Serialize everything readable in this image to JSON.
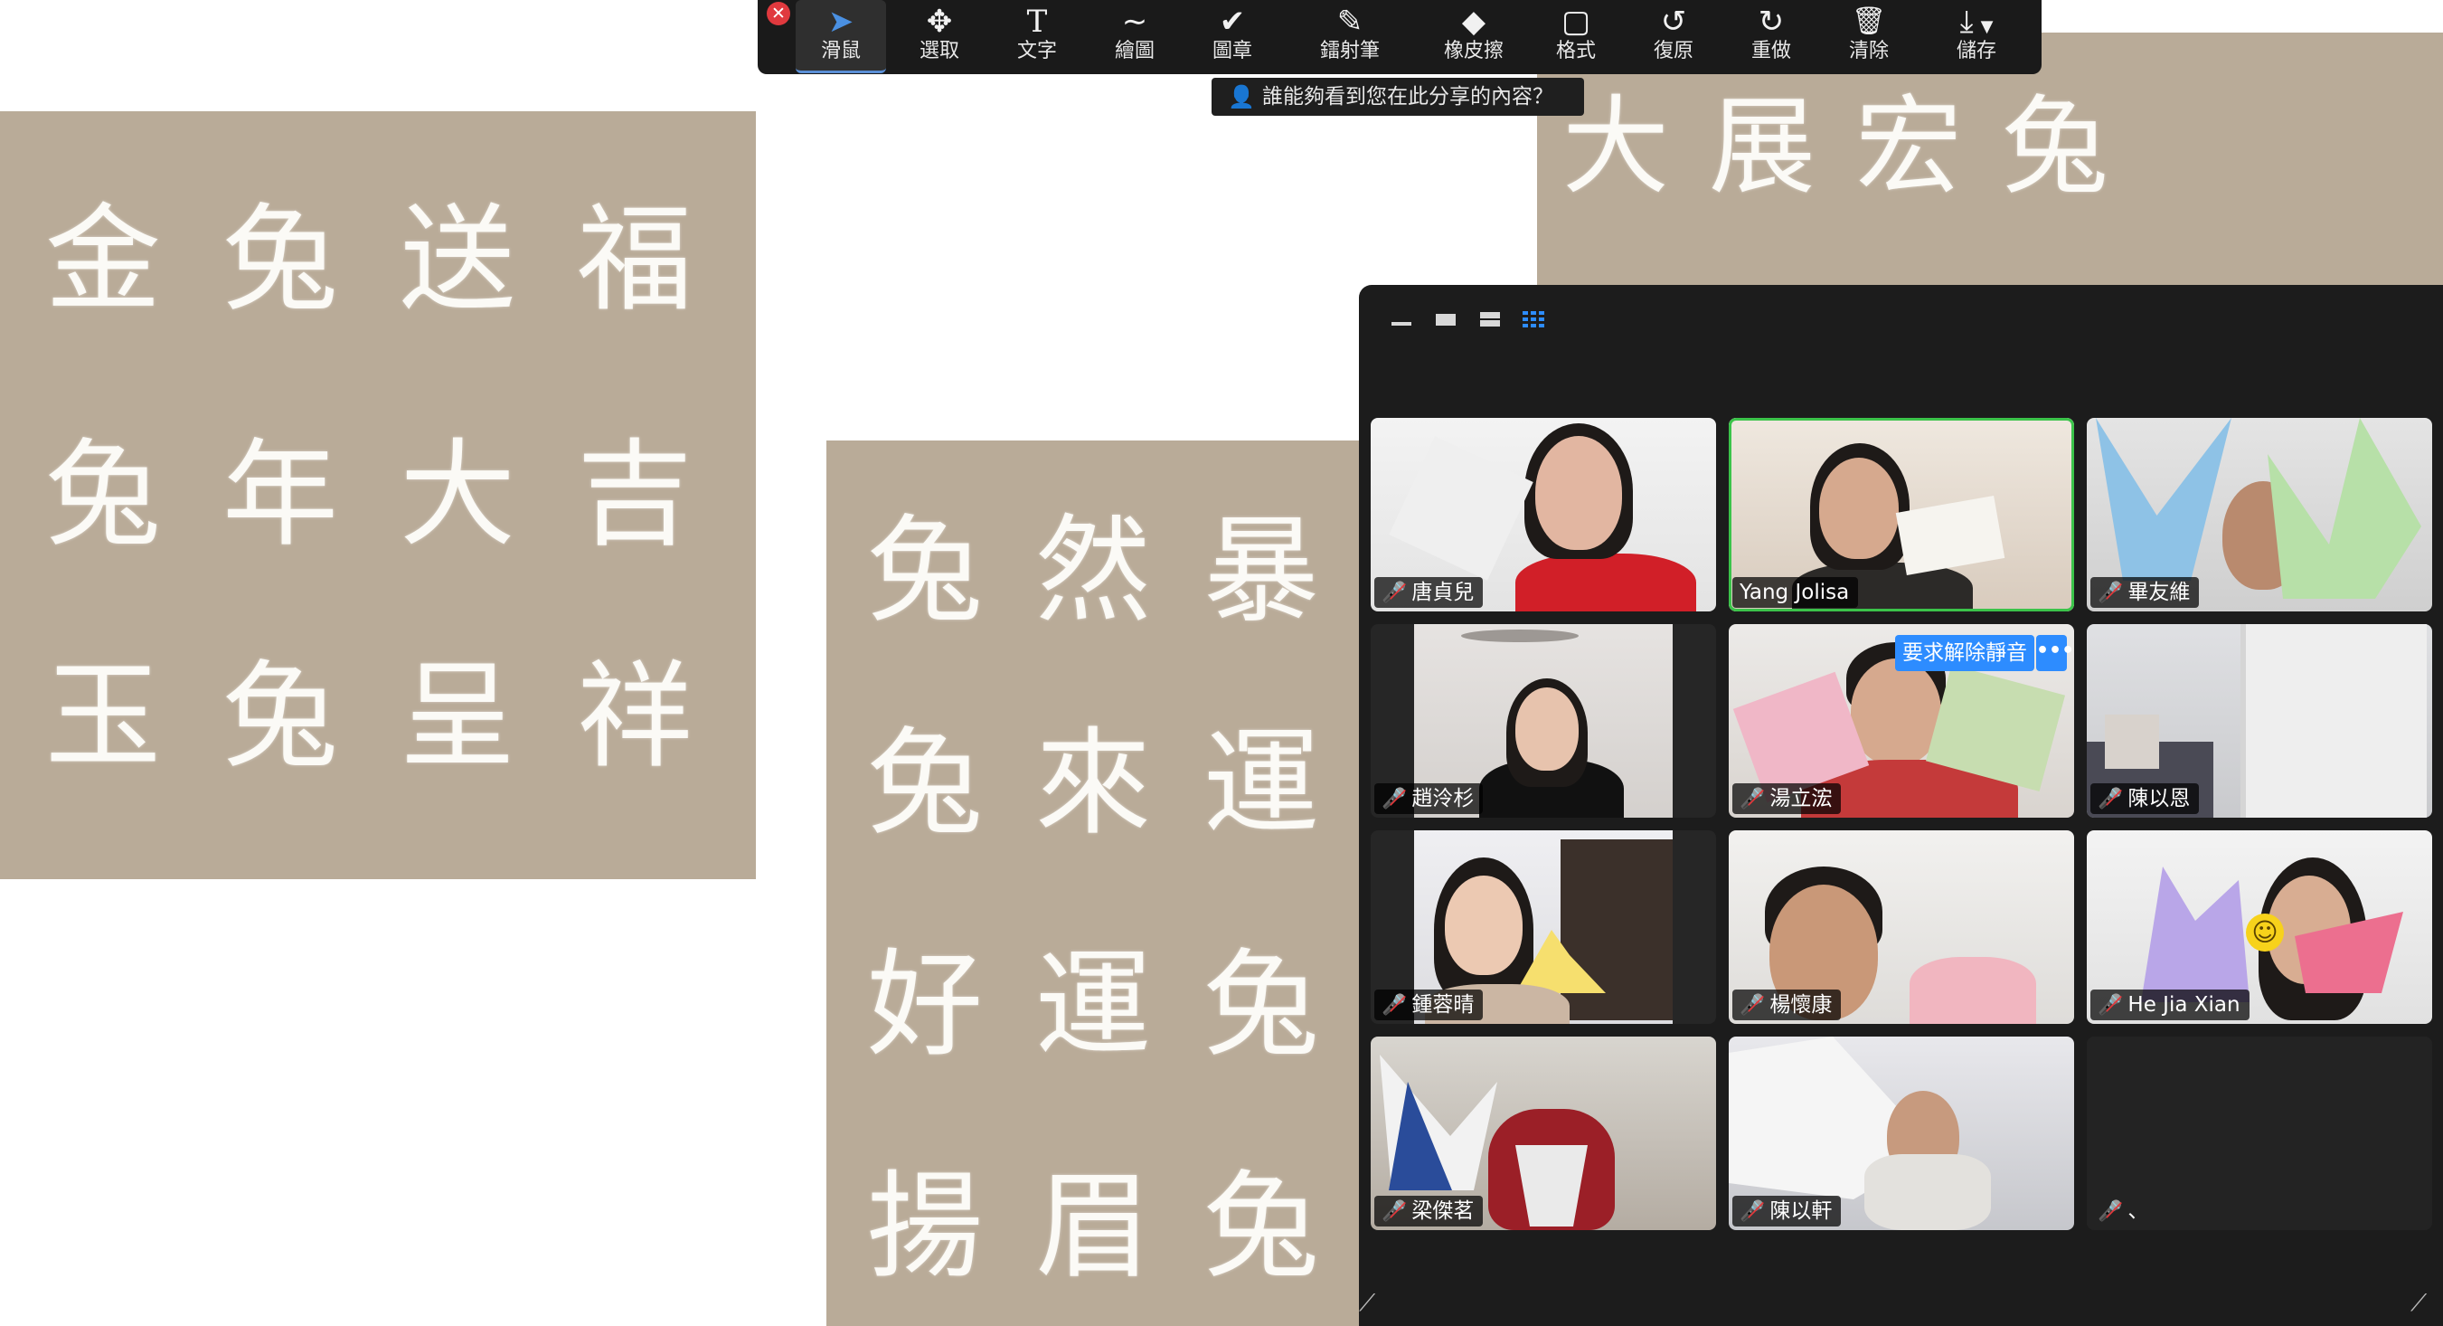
{
  "board1": {
    "lines": [
      "金兔送福",
      "兔年大吉",
      "玉兔呈祥"
    ]
  },
  "board2": {
    "lines": [
      "兔然暴富",
      "兔來運轉",
      "好運兔來",
      "揚眉兔氣"
    ]
  },
  "board3": {
    "lines": [
      "大展宏兔"
    ]
  },
  "toolbar": {
    "close_icon": "close-icon",
    "tools": [
      {
        "label": "滑鼠",
        "icon": "cursor-arrow-icon",
        "glyph": "➤"
      },
      {
        "label": "選取",
        "icon": "move-select-icon",
        "glyph": "✥"
      },
      {
        "label": "文字",
        "icon": "text-icon",
        "glyph": "T"
      },
      {
        "label": "繪圖",
        "icon": "draw-squiggle-icon",
        "glyph": "∼"
      },
      {
        "label": "圖章",
        "icon": "stamp-check-icon",
        "glyph": "✔"
      },
      {
        "label": "鐳射筆",
        "icon": "laser-pen-icon",
        "glyph": "✎"
      },
      {
        "label": "橡皮擦",
        "icon": "eraser-icon",
        "glyph": "◆"
      },
      {
        "label": "格式",
        "icon": "format-square-icon",
        "glyph": "▢"
      },
      {
        "label": "復原",
        "icon": "undo-icon",
        "glyph": "↺"
      },
      {
        "label": "重做",
        "icon": "redo-icon",
        "glyph": "↻"
      },
      {
        "label": "清除",
        "icon": "trash-icon",
        "glyph": "🗑"
      },
      {
        "label": "儲存",
        "icon": "save-download-icon",
        "glyph": "⤓"
      }
    ]
  },
  "share_notice": "誰能夠看到您在此分享的內容？",
  "gallery": {
    "unmute_request": "要求解除靜音",
    "more": "•••",
    "participants": [
      {
        "name": "唐貞兒",
        "muted": true
      },
      {
        "name": "Yang Jolisa",
        "muted": false
      },
      {
        "name": "畢友維",
        "muted": true
      },
      {
        "name": "趙泠杉",
        "muted": true
      },
      {
        "name": "湯立浤",
        "muted": true
      },
      {
        "name": "陳以恩",
        "muted": true
      },
      {
        "name": "鍾蓉晴",
        "muted": true
      },
      {
        "name": "楊懷康",
        "muted": true
      },
      {
        "name": "He Jia Xian",
        "muted": true
      },
      {
        "name": "梁傑茗",
        "muted": true
      },
      {
        "name": "陳以軒",
        "muted": true
      },
      {
        "name": "、",
        "muted": true
      }
    ]
  },
  "colors": {
    "muted_mic": "#e5383b",
    "speaking": "#3bc34a",
    "accent": "#2d8cff"
  }
}
